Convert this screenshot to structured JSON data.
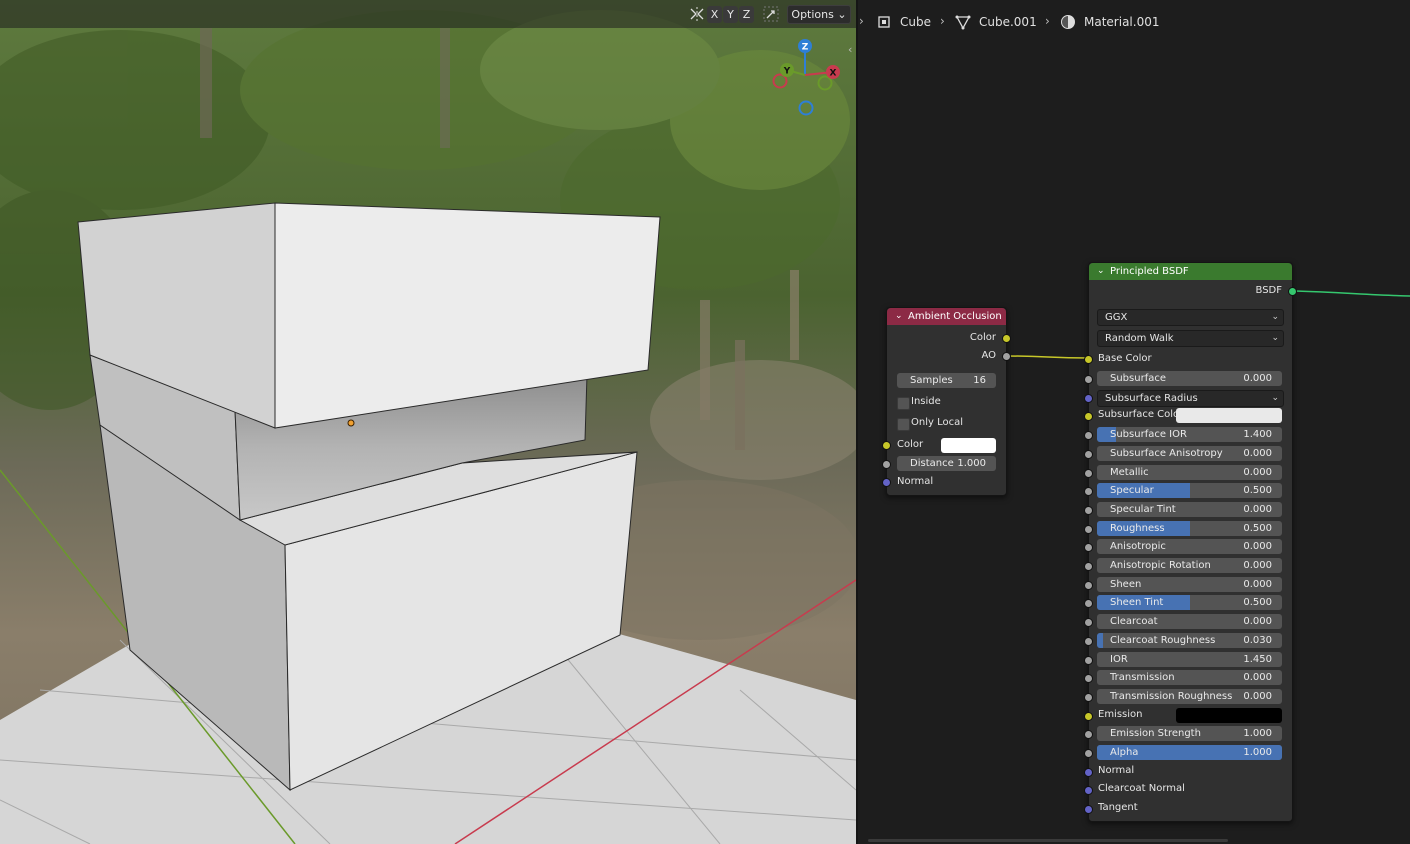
{
  "viewport": {
    "axis_toggles": [
      "X",
      "Y",
      "Z"
    ],
    "options_label": "Options",
    "gizmo": {
      "z": "Z",
      "y": "Y",
      "x": "X"
    },
    "colors": {
      "x_axis": "#c83b4e",
      "y_axis": "#6a9a2a",
      "z_axis": "#2e7fd6"
    }
  },
  "breadcrumb": {
    "items": [
      "Cube",
      "Cube.001",
      "Material.001"
    ]
  },
  "ao_node": {
    "title": "Ambient Occlusion",
    "header_color": "#8c2a45",
    "outputs": [
      "Color",
      "AO"
    ],
    "samples_label": "Samples",
    "samples_value": "16",
    "inside_label": "Inside",
    "only_local_label": "Only Local",
    "inputs": {
      "color_label": "Color",
      "color_value": "#ffffff",
      "distance_label": "Distance",
      "distance_value": "1.000",
      "normal_label": "Normal"
    }
  },
  "bsdf_node": {
    "title": "Principled BSDF",
    "header_color": "#3a7a2e",
    "output": "BSDF",
    "distribution": "GGX",
    "subsurface_method": "Random Walk",
    "base_color_label": "Base Color",
    "rows": [
      {
        "label": "Subsurface",
        "value": "0.000",
        "fill": 0.0
      },
      {
        "label": "Subsurface Radius",
        "dropdown": true
      },
      {
        "label": "Subsurface Color",
        "swatch": "#e9e9e9"
      },
      {
        "label": "Subsurface IOR",
        "value": "1.400",
        "fill": 0.1
      },
      {
        "label": "Subsurface Anisotropy",
        "value": "0.000",
        "fill": 0.0
      },
      {
        "label": "Metallic",
        "value": "0.000",
        "fill": 0.0
      },
      {
        "label": "Specular",
        "value": "0.500",
        "fill": 0.5
      },
      {
        "label": "Specular Tint",
        "value": "0.000",
        "fill": 0.0
      },
      {
        "label": "Roughness",
        "value": "0.500",
        "fill": 0.5
      },
      {
        "label": "Anisotropic",
        "value": "0.000",
        "fill": 0.0
      },
      {
        "label": "Anisotropic Rotation",
        "value": "0.000",
        "fill": 0.0
      },
      {
        "label": "Sheen",
        "value": "0.000",
        "fill": 0.0
      },
      {
        "label": "Sheen Tint",
        "value": "0.500",
        "fill": 0.5
      },
      {
        "label": "Clearcoat",
        "value": "0.000",
        "fill": 0.0
      },
      {
        "label": "Clearcoat Roughness",
        "value": "0.030",
        "fill": 0.03
      },
      {
        "label": "IOR",
        "value": "1.450",
        "fill": 0.0
      },
      {
        "label": "Transmission",
        "value": "0.000",
        "fill": 0.0
      },
      {
        "label": "Transmission Roughness",
        "value": "0.000",
        "fill": 0.0
      },
      {
        "label": "Emission",
        "swatch": "#000000"
      },
      {
        "label": "Emission Strength",
        "value": "1.000",
        "fill": 0.0
      },
      {
        "label": "Alpha",
        "value": "1.000",
        "fill": 1.0
      },
      {
        "label": "Normal",
        "plain": true
      },
      {
        "label": "Clearcoat Normal",
        "plain": true
      },
      {
        "label": "Tangent",
        "plain": true
      }
    ]
  }
}
